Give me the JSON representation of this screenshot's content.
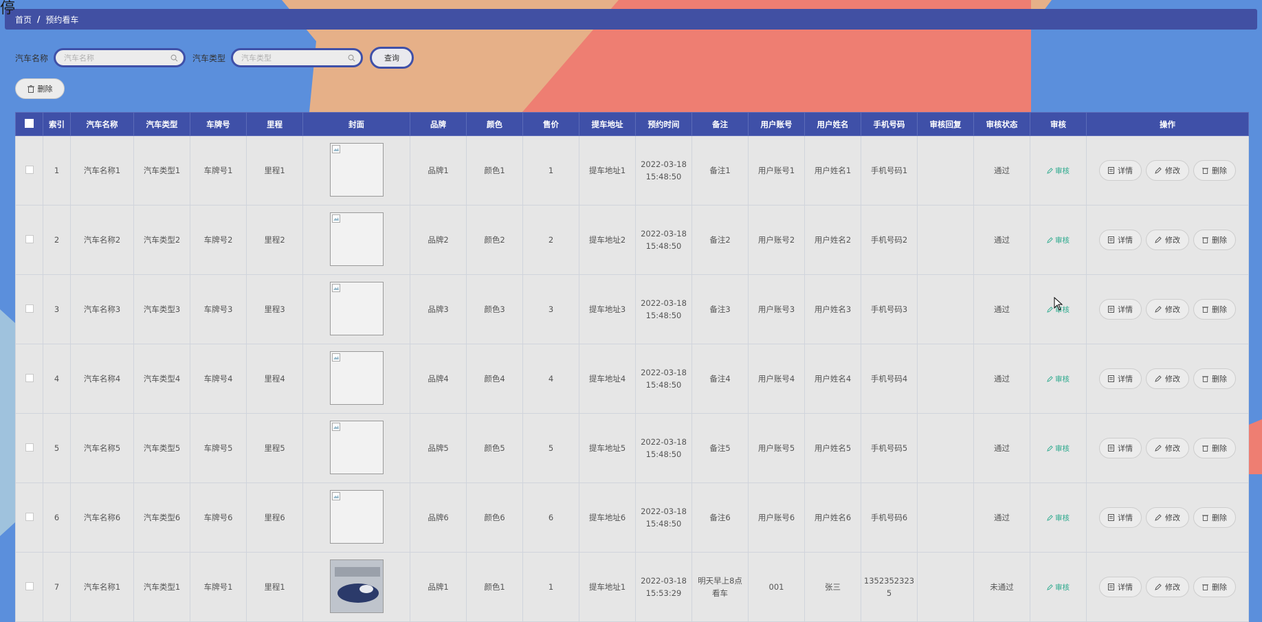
{
  "breadcrumb": {
    "home": "首页",
    "separator": "/",
    "current": "预约看车"
  },
  "corner_glyph": "停",
  "search": {
    "name_label": "汽车名称",
    "name_placeholder": "汽车名称",
    "type_label": "汽车类型",
    "type_placeholder": "汽车类型",
    "query_label": "查询"
  },
  "toolbar": {
    "delete_label": "删除"
  },
  "colors": {
    "header_bar": "#4150a3",
    "table_header": "#3f50a8",
    "audit_link": "#2eaa8e",
    "bg_blue": "#5b8fdc",
    "bg_orange": "#e6b088",
    "bg_red": "#ee7e72"
  },
  "table": {
    "columns": [
      "索引",
      "汽车名称",
      "汽车类型",
      "车牌号",
      "里程",
      "封面",
      "品牌",
      "颜色",
      "售价",
      "提车地址",
      "预约时间",
      "备注",
      "用户账号",
      "用户姓名",
      "手机号码",
      "审核回复",
      "审核状态",
      "审核",
      "操作"
    ],
    "audit_label": "审核",
    "actions": {
      "detail": "详情",
      "edit": "修改",
      "delete": "删除"
    },
    "rows": [
      {
        "index": "1",
        "name": "汽车名称1",
        "type": "汽车类型1",
        "plate": "车牌号1",
        "mileage": "里程1",
        "brand": "品牌1",
        "color": "颜色1",
        "price": "1",
        "address": "提车地址1",
        "time_date": "2022-03-18",
        "time_clock": "15:48:50",
        "note": "备注1",
        "note_2": "",
        "account": "用户账号1",
        "username": "用户姓名1",
        "phone": "手机号码1",
        "phone_2": "",
        "reply": "",
        "status": "通过"
      },
      {
        "index": "2",
        "name": "汽车名称2",
        "type": "汽车类型2",
        "plate": "车牌号2",
        "mileage": "里程2",
        "brand": "品牌2",
        "color": "颜色2",
        "price": "2",
        "address": "提车地址2",
        "time_date": "2022-03-18",
        "time_clock": "15:48:50",
        "note": "备注2",
        "note_2": "",
        "account": "用户账号2",
        "username": "用户姓名2",
        "phone": "手机号码2",
        "phone_2": "",
        "reply": "",
        "status": "通过"
      },
      {
        "index": "3",
        "name": "汽车名称3",
        "type": "汽车类型3",
        "plate": "车牌号3",
        "mileage": "里程3",
        "brand": "品牌3",
        "color": "颜色3",
        "price": "3",
        "address": "提车地址3",
        "time_date": "2022-03-18",
        "time_clock": "15:48:50",
        "note": "备注3",
        "note_2": "",
        "account": "用户账号3",
        "username": "用户姓名3",
        "phone": "手机号码3",
        "phone_2": "",
        "reply": "",
        "status": "通过"
      },
      {
        "index": "4",
        "name": "汽车名称4",
        "type": "汽车类型4",
        "plate": "车牌号4",
        "mileage": "里程4",
        "brand": "品牌4",
        "color": "颜色4",
        "price": "4",
        "address": "提车地址4",
        "time_date": "2022-03-18",
        "time_clock": "15:48:50",
        "note": "备注4",
        "note_2": "",
        "account": "用户账号4",
        "username": "用户姓名4",
        "phone": "手机号码4",
        "phone_2": "",
        "reply": "",
        "status": "通过"
      },
      {
        "index": "5",
        "name": "汽车名称5",
        "type": "汽车类型5",
        "plate": "车牌号5",
        "mileage": "里程5",
        "brand": "品牌5",
        "color": "颜色5",
        "price": "5",
        "address": "提车地址5",
        "time_date": "2022-03-18",
        "time_clock": "15:48:50",
        "note": "备注5",
        "note_2": "",
        "account": "用户账号5",
        "username": "用户姓名5",
        "phone": "手机号码5",
        "phone_2": "",
        "reply": "",
        "status": "通过"
      },
      {
        "index": "6",
        "name": "汽车名称6",
        "type": "汽车类型6",
        "plate": "车牌号6",
        "mileage": "里程6",
        "brand": "品牌6",
        "color": "颜色6",
        "price": "6",
        "address": "提车地址6",
        "time_date": "2022-03-18",
        "time_clock": "15:48:50",
        "note": "备注6",
        "note_2": "",
        "account": "用户账号6",
        "username": "用户姓名6",
        "phone": "手机号码6",
        "phone_2": "",
        "reply": "",
        "status": "通过"
      },
      {
        "index": "7",
        "name": "汽车名称1",
        "type": "汽车类型1",
        "plate": "车牌号1",
        "mileage": "里程1",
        "brand": "品牌1",
        "color": "颜色1",
        "price": "1",
        "address": "提车地址1",
        "time_date": "2022-03-18",
        "time_clock": "15:53:29",
        "note": "明天早上8点",
        "note_2": "看车",
        "account": "001",
        "username": "张三",
        "phone": "1352352323",
        "phone_2": "5",
        "reply": "",
        "status": "未通过",
        "photo": true
      }
    ]
  }
}
